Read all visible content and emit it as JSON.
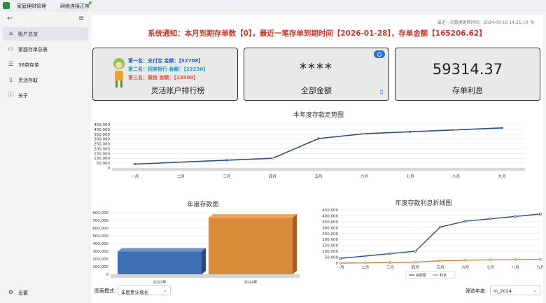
{
  "window": {
    "title": "家庭理财管理",
    "network_status": "网络连接正常"
  },
  "sidebar": {
    "items": [
      {
        "label": "账户总览",
        "icon": "home-icon"
      },
      {
        "label": "家庭存单总表",
        "icon": "calendar-icon"
      },
      {
        "label": "36单存单",
        "icon": "list-icon"
      },
      {
        "label": "灵活存取",
        "icon": "phone-icon"
      },
      {
        "label": "关于",
        "icon": "info-icon"
      }
    ],
    "settings_label": "设置"
  },
  "header": {
    "last_update_label": "最近一次数据更新时间:",
    "last_update_time": "2024-09-16 14:21:19",
    "notice": "系统通知：本月到期存单数【0】，最近一笔存单到期时间【2026-01-28】，存单金额【165206.62】"
  },
  "cards": {
    "ranking": {
      "first": "第一名：支付宝  金额：【52708】",
      "second": "第二名：招商银行  金额：【22230】",
      "third": "第三名：微信  金额：【13500】",
      "title": "灵活账户排行榜"
    },
    "total": {
      "value": "****",
      "title": "全部金额"
    },
    "interest": {
      "value": "59314.37",
      "title": "存单利息"
    }
  },
  "chart_data": [
    {
      "type": "line",
      "title": "本年度存款走势图",
      "categories": [
        "一月",
        "二月",
        "三月",
        "四月",
        "五月",
        "六月",
        "七月",
        "八月",
        "九月"
      ],
      "values": [
        40000,
        60000,
        80000,
        100000,
        305000,
        355000,
        375000,
        395000,
        415000
      ],
      "yticks": [
        "450,000",
        "400,000",
        "350,000",
        "300,000",
        "250,000",
        "200,000",
        "150,000",
        "100,000",
        "50,000",
        "0"
      ],
      "ylim": [
        0,
        450000
      ]
    },
    {
      "type": "bar",
      "title": "年度存款图",
      "categories": [
        "2023年",
        "2024年"
      ],
      "values": [
        295000,
        735000
      ],
      "yticks": [
        "800,000",
        "700,000",
        "600,000",
        "500,000",
        "400,000",
        "300,000",
        "200,000",
        "100,000",
        "0"
      ],
      "ylim": [
        0,
        800000
      ]
    },
    {
      "type": "line",
      "title": "年度存款利息折线图",
      "categories": [
        "一月",
        "二月",
        "三月",
        "四月",
        "五月",
        "六月",
        "七月",
        "八月",
        "九月"
      ],
      "series": [
        {
          "name": "存款额",
          "values": [
            40000,
            60000,
            80000,
            100000,
            305000,
            355000,
            375000,
            395000,
            415000
          ]
        },
        {
          "name": "利息",
          "values": [
            0,
            2000,
            5000,
            8000,
            20000,
            25000,
            28000,
            30000,
            32000
          ]
        }
      ],
      "yticks": [
        "450,000",
        "400,000",
        "350,000",
        "300,000",
        "250,000",
        "200,000",
        "150,000",
        "100,000",
        "50,000",
        "0"
      ],
      "ylim": [
        0,
        450000
      ]
    }
  ],
  "footer": {
    "chart_mode_label": "图表模式:",
    "chart_mode_value": "年度累计增长",
    "year_filter_label": "筛选年度:",
    "year_filter_value": "In_2024"
  },
  "colors": {
    "line": "#2f4f7f",
    "interest": "#c8843a",
    "bar2023": "#3d6fb5",
    "bar2024": "#d98b3a",
    "notice": "#c0392b",
    "accent": "#1f6fd6"
  }
}
